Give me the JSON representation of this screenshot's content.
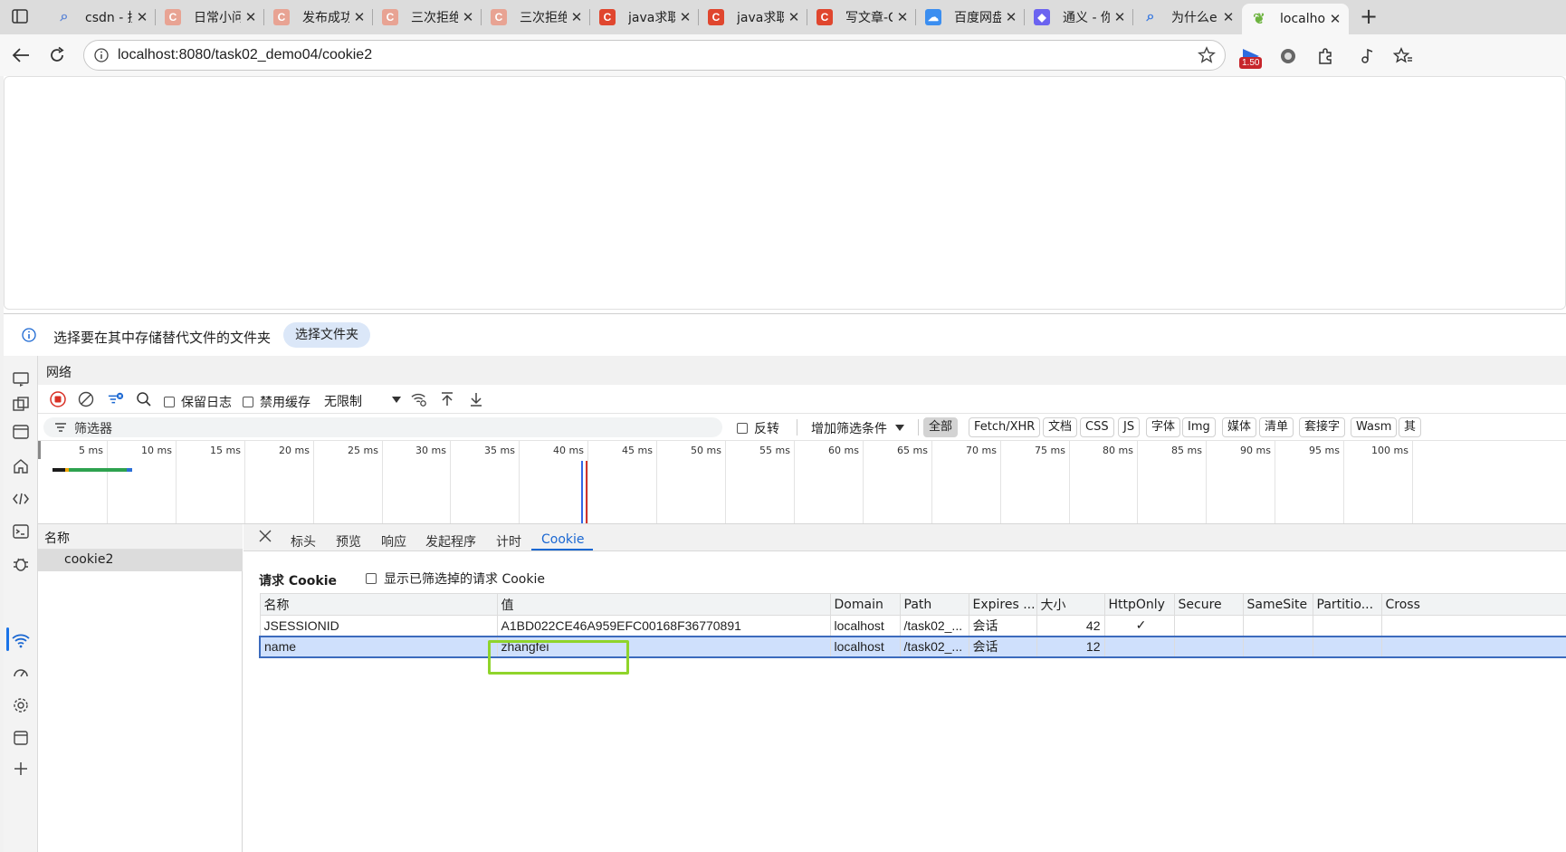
{
  "browser": {
    "tabs": [
      {
        "title": "csdn - 搜",
        "icon": "search-icon",
        "color": "#5f87d6"
      },
      {
        "title": "日常小问",
        "icon": "csdn-icon",
        "color": "#e8a393"
      },
      {
        "title": "发布成功",
        "icon": "csdn-icon",
        "color": "#e8a393"
      },
      {
        "title": "三次拒绝",
        "icon": "csdn-icon",
        "color": "#e8a393"
      },
      {
        "title": "三次拒绝",
        "icon": "csdn-icon",
        "color": "#e8a393"
      },
      {
        "title": "java求职",
        "icon": "csdn-icon",
        "color": "#e0462e"
      },
      {
        "title": "java求职",
        "icon": "csdn-icon",
        "color": "#e0462e"
      },
      {
        "title": "写文章-C",
        "icon": "csdn-icon",
        "color": "#e0462e"
      },
      {
        "title": "百度网盘",
        "icon": "baidu-netdisk-icon",
        "color": "#3b8ef0"
      },
      {
        "title": "通义 - 你",
        "icon": "tongyi-icon",
        "color": "#6b63f0"
      },
      {
        "title": "为什么e",
        "icon": "search-icon",
        "color": "#3b7be0"
      },
      {
        "title": "localhos",
        "icon": "spring-leaf-icon",
        "color": "#6db33f"
      }
    ],
    "url": "localhost:8080/task02_demo04/cookie2",
    "extension_badge": "1.50"
  },
  "devtools": {
    "infobar": {
      "message": "选择要在其中存储替代文件的文件夹",
      "button": "选择文件夹"
    },
    "panel_title": "网络",
    "toolbar": {
      "preserve_log": "保留日志",
      "disable_cache": "禁用缓存",
      "throttling": "无限制"
    },
    "filter": {
      "placeholder": "筛选器",
      "invert": "反转",
      "more_filters": "增加筛选条件",
      "types": [
        "全部",
        "Fetch/XHR",
        "文档",
        "CSS",
        "JS",
        "字体",
        "Img",
        "媒体",
        "清单",
        "套接字",
        "Wasm",
        "其"
      ]
    },
    "timeline": {
      "ticks": [
        "5 ms",
        "10 ms",
        "15 ms",
        "20 ms",
        "25 ms",
        "30 ms",
        "35 ms",
        "40 ms",
        "45 ms",
        "50 ms",
        "55 ms",
        "60 ms",
        "65 ms",
        "70 ms",
        "75 ms",
        "80 ms",
        "85 ms",
        "90 ms",
        "95 ms",
        "100 ms"
      ]
    },
    "requests": {
      "header": "名称",
      "items": [
        "cookie2"
      ]
    },
    "detail_tabs": [
      "标头",
      "预览",
      "响应",
      "发起程序",
      "计时",
      "Cookie"
    ],
    "active_detail_tab": "Cookie",
    "cookies": {
      "section_title": "请求 Cookie",
      "show_filtered": "显示已筛选掉的请求 Cookie",
      "columns": [
        "名称",
        "值",
        "Domain",
        "Path",
        "Expires ...",
        "大小",
        "HttpOnly",
        "Secure",
        "SameSite",
        "Partitio...",
        "Cross"
      ],
      "rows": [
        {
          "name": "JSESSIONID",
          "value": "A1BD022CE46A959EFC00168F36770891",
          "domain": "localhost",
          "path": "/task02_...",
          "expires": "会话",
          "size": "42",
          "httponly": "✓",
          "secure": "",
          "samesite": "",
          "partition": "",
          "cross": ""
        },
        {
          "name": "name",
          "value": "zhangfei",
          "domain": "localhost",
          "path": "/task02_...",
          "expires": "会话",
          "size": "12",
          "httponly": "",
          "secure": "",
          "samesite": "",
          "partition": "",
          "cross": ""
        }
      ]
    }
  }
}
